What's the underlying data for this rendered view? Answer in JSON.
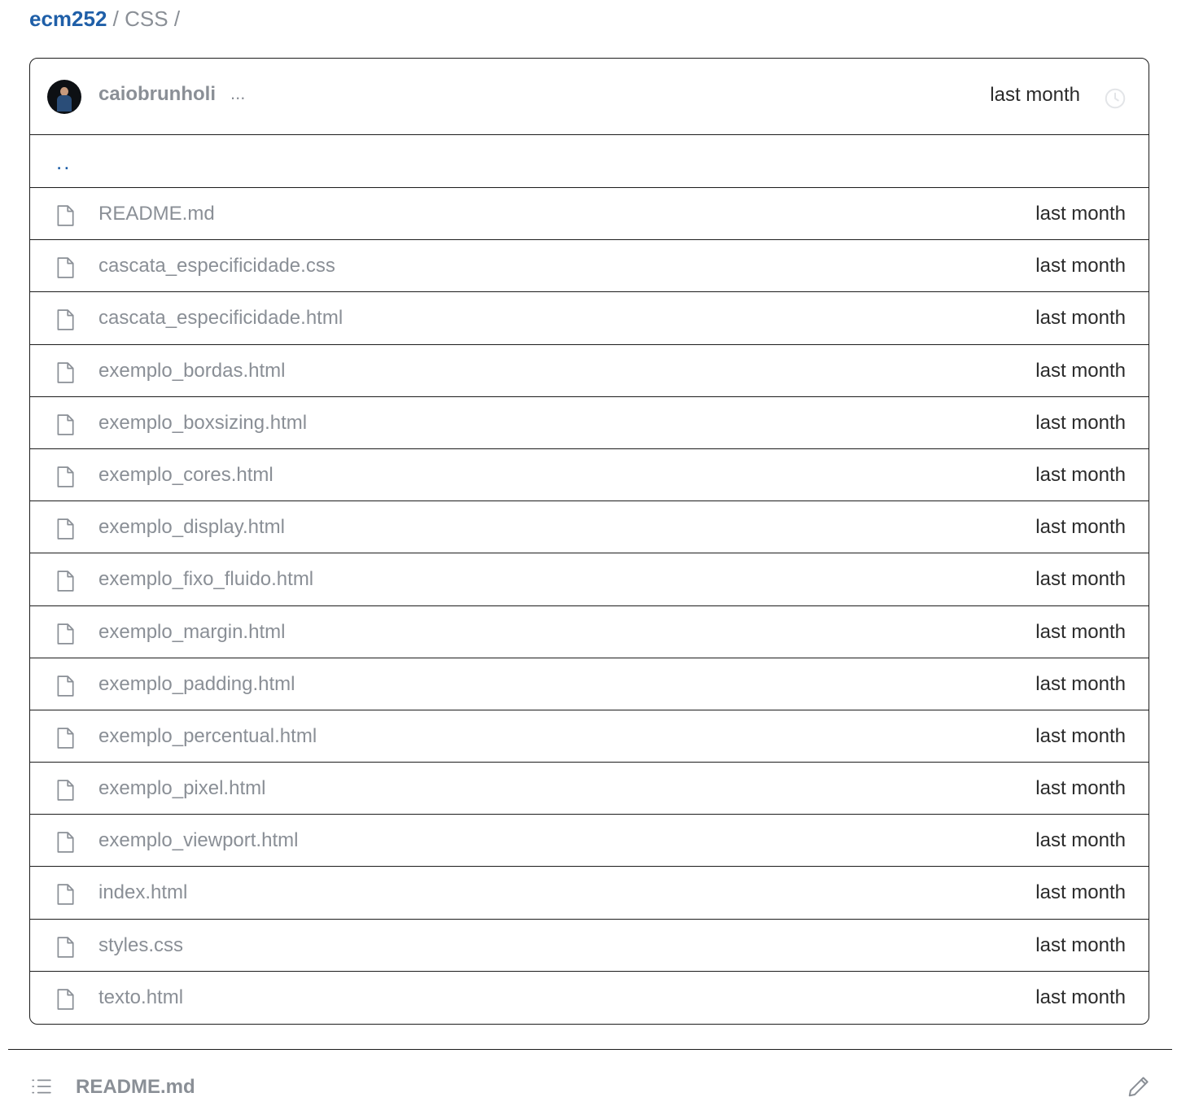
{
  "breadcrumb": {
    "repo": "ecm252",
    "sep1": "/",
    "dir": "CSS",
    "sep2": "/"
  },
  "commit": {
    "author": "caiobrunholi",
    "ellipsis": "...",
    "time": "last month",
    "avatar_icon": "avatar-image",
    "history_icon": "history-icon"
  },
  "parent": {
    "label": ".."
  },
  "files": [
    {
      "name": "README.md",
      "time": "last month"
    },
    {
      "name": "cascata_especificidade.css",
      "time": "last month"
    },
    {
      "name": "cascata_especificidade.html",
      "time": "last month"
    },
    {
      "name": "exemplo_bordas.html",
      "time": "last month"
    },
    {
      "name": "exemplo_boxsizing.html",
      "time": "last month"
    },
    {
      "name": "exemplo_cores.html",
      "time": "last month"
    },
    {
      "name": "exemplo_display.html",
      "time": "last month"
    },
    {
      "name": "exemplo_fixo_fluido.html",
      "time": "last month"
    },
    {
      "name": "exemplo_margin.html",
      "time": "last month"
    },
    {
      "name": "exemplo_padding.html",
      "time": "last month"
    },
    {
      "name": "exemplo_percentual.html",
      "time": "last month"
    },
    {
      "name": "exemplo_pixel.html",
      "time": "last month"
    },
    {
      "name": "exemplo_viewport.html",
      "time": "last month"
    },
    {
      "name": "index.html",
      "time": "last month"
    },
    {
      "name": "styles.css",
      "time": "last month"
    },
    {
      "name": "texto.html",
      "time": "last month"
    }
  ],
  "readme": {
    "title": "README.md",
    "toc_icon": "list-icon",
    "edit_icon": "pencil-icon"
  },
  "colors": {
    "link": "#1f5fa8",
    "muted": "#8a8f96",
    "border": "#1c1c1c"
  }
}
